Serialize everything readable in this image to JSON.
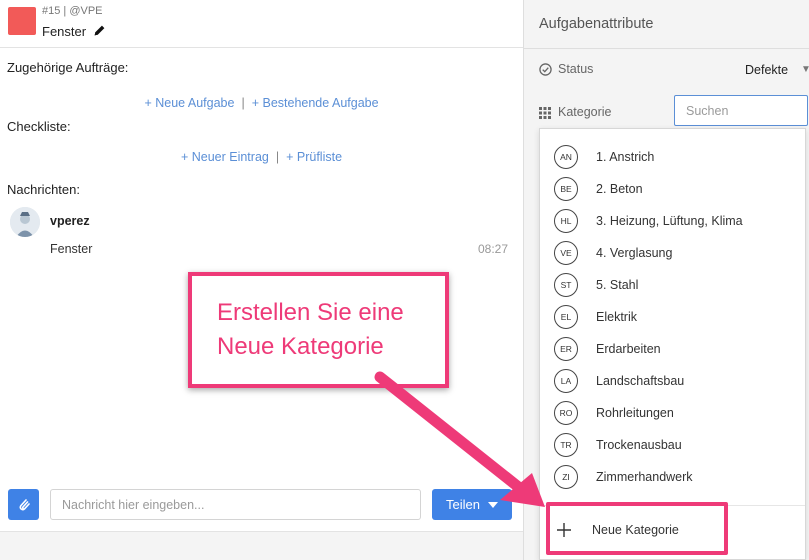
{
  "task": {
    "meta": "#15 | @VPE",
    "title": "Fenster",
    "swatch_color": "#f25a58"
  },
  "sections": {
    "orders_label": "Zugehörige Aufträge:",
    "checklist_label": "Checkliste:",
    "messages_label": "Nachrichten:"
  },
  "orders_links": {
    "new_task": "+ Neue Aufgabe",
    "existing_task": "+ Bestehende Aufgabe"
  },
  "checklist_links": {
    "new_entry": "+ Neuer Eintrag",
    "checklist": "+ Prüfliste"
  },
  "message": {
    "user": "vperez",
    "text": "Fenster",
    "time": "08:27"
  },
  "composer": {
    "placeholder": "Nachricht hier eingeben...",
    "share_label": "Teilen"
  },
  "attributes": {
    "title": "Aufgabenattribute",
    "status_label": "Status",
    "status_value": "Defekte",
    "category_label": "Kategorie",
    "search_placeholder": "Suchen"
  },
  "categories": [
    {
      "code": "AN",
      "label": "1. Anstrich"
    },
    {
      "code": "BE",
      "label": "2. Beton"
    },
    {
      "code": "HL",
      "label": "3. Heizung, Lüftung, Klima"
    },
    {
      "code": "VE",
      "label": "4. Verglasung"
    },
    {
      "code": "ST",
      "label": "5. Stahl"
    },
    {
      "code": "EL",
      "label": "Elektrik"
    },
    {
      "code": "ER",
      "label": "Erdarbeiten"
    },
    {
      "code": "LA",
      "label": "Landschaftsbau"
    },
    {
      "code": "RO",
      "label": "Rohrleitungen"
    },
    {
      "code": "TR",
      "label": "Trockenausbau"
    },
    {
      "code": "ZI",
      "label": "Zimmerhandwerk"
    }
  ],
  "new_category_label": "Neue Kategorie",
  "annotation": {
    "line1": "Erstellen Sie eine",
    "line2": "Neue Kategorie",
    "color": "#ee3a78"
  },
  "colors": {
    "accent": "#3f82e6",
    "link": "#5b8fd6"
  }
}
